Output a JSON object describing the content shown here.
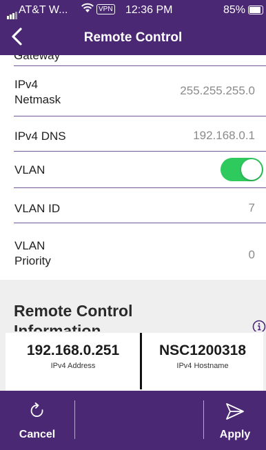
{
  "status_bar": {
    "carrier": "AT&T W...",
    "vpn": "VPN",
    "time": "12:36 PM",
    "battery": "85%",
    "icons": [
      "signal-icon",
      "wifi-icon",
      "battery-icon"
    ]
  },
  "nav": {
    "title": "Remote Control",
    "back_icon": "chevron-left-icon"
  },
  "settings": {
    "clipped_label": "Gateway",
    "netmask_label": "IPv4\nNetmask",
    "netmask_value": "255.255.255.0",
    "dns_label": "IPv4 DNS",
    "dns_value": "192.168.0.1",
    "vlan_label": "VLAN",
    "vlan_enabled": true,
    "vlan_id_label": "VLAN ID",
    "vlan_id_value": "7",
    "vlan_priority_label": "VLAN\nPriority",
    "vlan_priority_value": "0"
  },
  "info": {
    "heading": "Remote Control\nInformation",
    "info_icon": "info-icon",
    "ipv4_address": "192.168.0.251",
    "ipv4_address_label": "IPv4 Address",
    "ipv4_hostname": "NSC1200318",
    "ipv4_hostname_label": "IPv4 Hostname"
  },
  "footer": {
    "cancel_label": "Cancel",
    "cancel_icon": "refresh-icon",
    "apply_label": "Apply",
    "apply_icon": "send-icon"
  },
  "colors": {
    "brand": "#4b2873",
    "toggle_on": "#2fca5e",
    "section_bg": "#efefef",
    "value_text": "#8a8a8a"
  }
}
